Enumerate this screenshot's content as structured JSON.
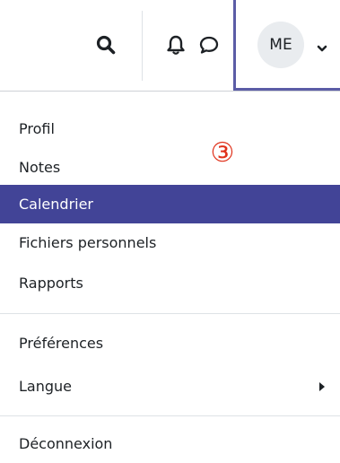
{
  "navbar": {
    "icons": [
      "search-icon",
      "bell-icon",
      "chat-bubble-icon"
    ],
    "user_initials": "ME",
    "accent_color": "#5b5ca6"
  },
  "annotation": {
    "step_marker": "③",
    "color": "#e0311b"
  },
  "menu": {
    "items": [
      {
        "label": "Profil"
      },
      {
        "label": "Notes"
      },
      {
        "label": "Calendrier",
        "active": true
      },
      {
        "label": "Fichiers personnels"
      },
      {
        "label": "Rapports"
      },
      {
        "label": "Préférences"
      },
      {
        "label": "Langue",
        "has_submenu": true
      },
      {
        "label": "Déconnexion"
      }
    ],
    "active_color": "#424497"
  }
}
